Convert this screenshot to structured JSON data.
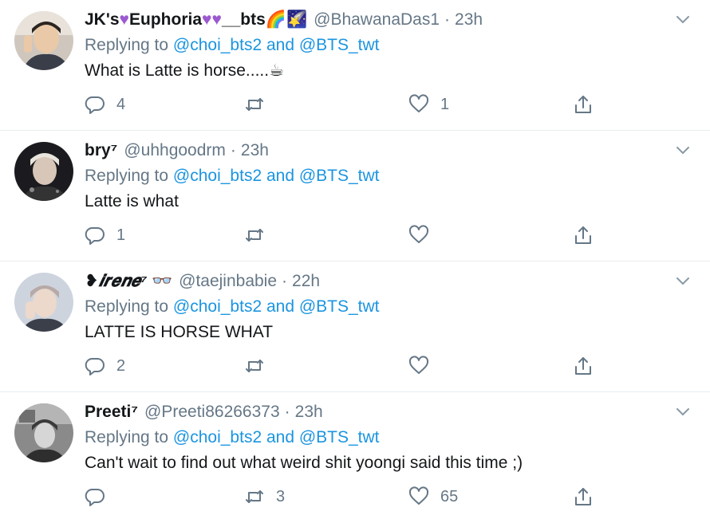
{
  "colors": {
    "link": "#1b95e0",
    "muted": "#657786",
    "divider": "#e6ecf0"
  },
  "reply_prefix": "Replying to",
  "reply_targets": "@choi_bts2 and @BTS_twt",
  "tweets": [
    {
      "name_main": "JK's",
      "name_mid": "Euphoria",
      "name_tail": "__bts",
      "name_emoji": "💜💜💜🌈🌠",
      "handle": "@BhawanaDas1",
      "time": "23h",
      "text": "What is Latte is horse.....☕",
      "reply_count": "4",
      "retweet_count": "",
      "like_count": "1",
      "icons": [
        "reply-icon",
        "retweet-icon",
        "like-icon",
        "share-icon",
        "caret-down-icon"
      ]
    },
    {
      "name_main": "bry⁷",
      "handle": "@uhhgoodrm",
      "time": "23h",
      "text": "Latte is what",
      "reply_count": "1",
      "retweet_count": "",
      "like_count": ""
    },
    {
      "name_main": "❥𝒊𝒓𝒆𝒏𝒆⁷",
      "name_emoji": "👓",
      "handle": "@taejinbabie",
      "time": "22h",
      "text": "LATTE IS HORSE WHAT",
      "reply_count": "2",
      "retweet_count": "",
      "like_count": ""
    },
    {
      "name_main": "Preeti⁷",
      "handle": "@Preeti86266373",
      "time": "23h",
      "text": "Can't wait to find out what weird shit yoongi said this time ;)",
      "reply_count": "",
      "retweet_count": "3",
      "like_count": "65"
    }
  ]
}
